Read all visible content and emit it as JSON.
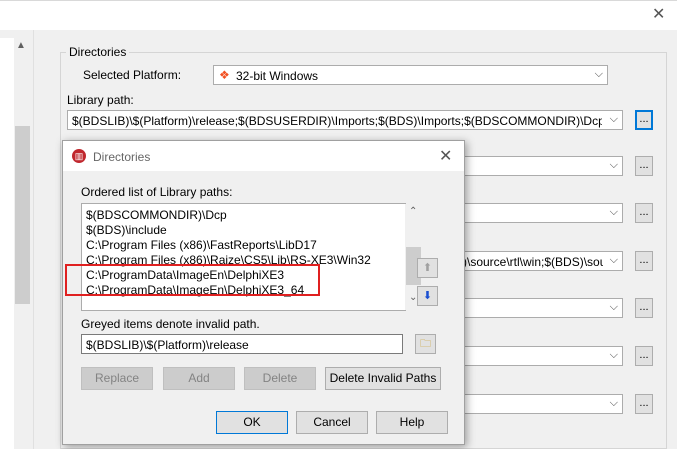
{
  "main": {
    "group_label": "Directories",
    "platform_label": "Selected Platform:",
    "platform_value": "32-bit Windows",
    "library_label": "Library path:",
    "library_value": "$(BDSLIB)\\$(Platform)\\release;$(BDSUSERDIR)\\Imports;$(BDS)\\Imports;$(BDSCOMMONDIR)\\Dcp;$(BDS)\\include",
    "browse_label": "...",
    "partial_combo_value": ")\\source\\rtl\\win;$(BDS)\\source"
  },
  "dialog": {
    "title": "Directories",
    "list_label": "Ordered list of Library paths:",
    "items": [
      "$(BDSCOMMONDIR)\\Dcp",
      "$(BDS)\\include",
      "C:\\Program Files (x86)\\FastReports\\LibD17",
      "C:\\Program Files (x86)\\Raize\\CS5\\Lib\\RS-XE3\\Win32",
      "C:\\ProgramData\\ImageEn\\DelphiXE3",
      "C:\\ProgramData\\ImageEn\\DelphiXE3_64"
    ],
    "greyed_note": "Greyed items denote invalid path.",
    "path_value": "$(BDSLIB)\\$(Platform)\\release",
    "buttons": {
      "replace": "Replace",
      "add": "Add",
      "delete": "Delete",
      "delete_invalid": "Delete Invalid Paths",
      "ok": "OK",
      "cancel": "Cancel",
      "help": "Help"
    }
  },
  "colors": {
    "highlight": "#e02020",
    "accent": "#0078d7"
  }
}
